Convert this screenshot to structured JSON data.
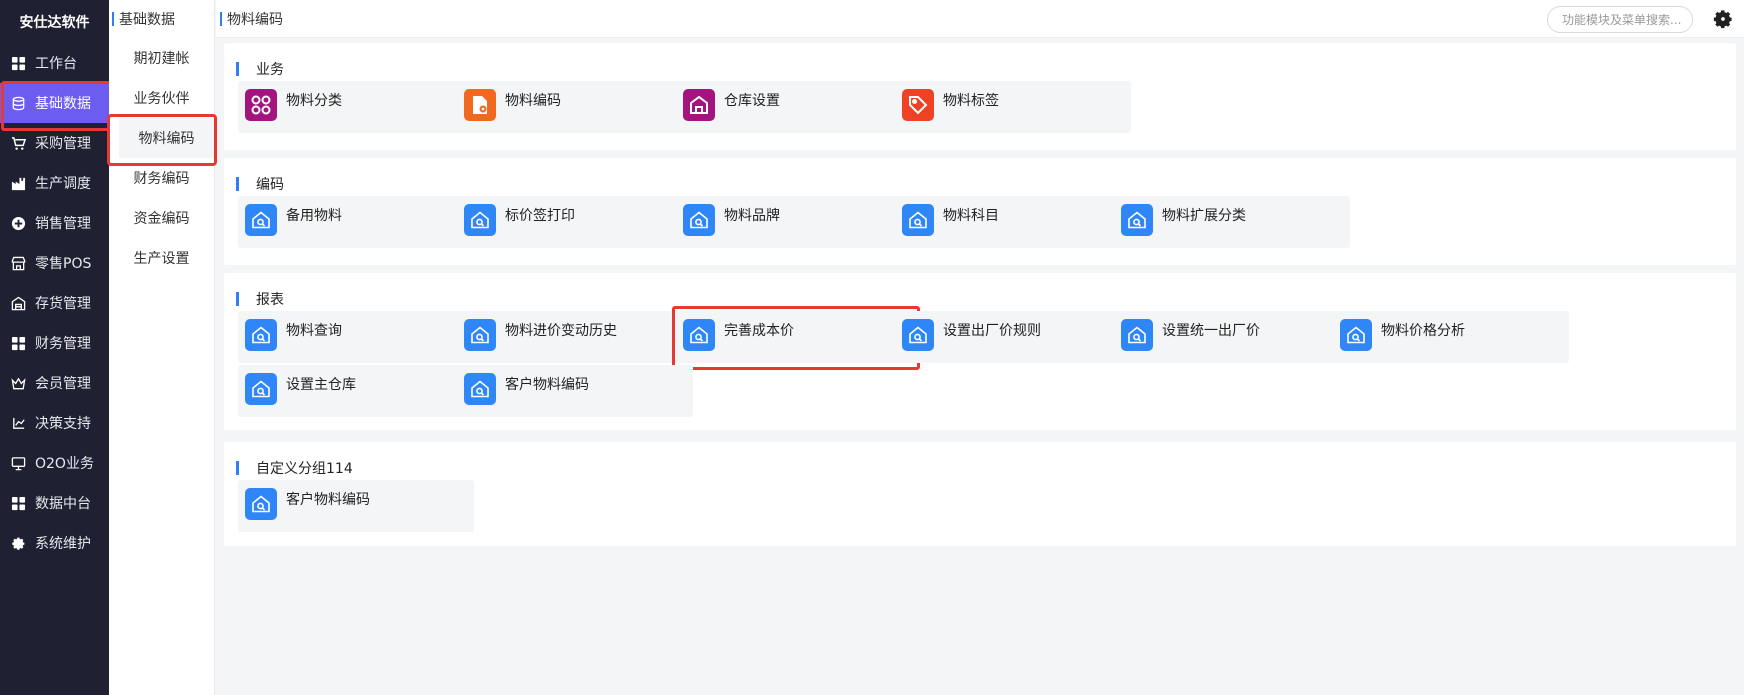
{
  "sidebar": {
    "brand": "安仕达软件",
    "items": [
      {
        "label": "工作台",
        "icon": "grid-icon"
      },
      {
        "label": "基础数据",
        "icon": "database-icon",
        "active": true
      },
      {
        "label": "采购管理",
        "icon": "cart-icon"
      },
      {
        "label": "生产调度",
        "icon": "factory-icon"
      },
      {
        "label": "销售管理",
        "icon": "sales-icon"
      },
      {
        "label": "零售POS",
        "icon": "store-icon"
      },
      {
        "label": "存货管理",
        "icon": "warehouse-icon"
      },
      {
        "label": "财务管理",
        "icon": "grid-icon"
      },
      {
        "label": "会员管理",
        "icon": "crown-icon"
      },
      {
        "label": "决策支持",
        "icon": "decision-icon"
      },
      {
        "label": "O2O业务",
        "icon": "monitor-icon"
      },
      {
        "label": "数据中台",
        "icon": "grid-icon"
      },
      {
        "label": "系统维护",
        "icon": "gear-icon"
      }
    ]
  },
  "submenu": {
    "title": "基础数据",
    "items": [
      {
        "label": "期初建帐"
      },
      {
        "label": "业务伙伴"
      },
      {
        "label": "物料编码",
        "active": true
      },
      {
        "label": "财务编码"
      },
      {
        "label": "资金编码"
      },
      {
        "label": "生产设置"
      }
    ]
  },
  "topbar": {
    "breadcrumb": "物料编码",
    "search_placeholder": "功能模块及菜单搜索..."
  },
  "sections": [
    {
      "title": "业务",
      "tiles": [
        {
          "label": "物料分类",
          "icon": "category-icon",
          "color": "#a3157e"
        },
        {
          "label": "物料编码",
          "icon": "document-gear-icon",
          "color": "#f0691e"
        },
        {
          "label": "仓库设置",
          "icon": "warehouse-icon",
          "color": "#a3157e"
        },
        {
          "label": "物料标签",
          "icon": "tag-icon",
          "color": "#ee4224"
        }
      ]
    },
    {
      "title": "编码",
      "tiles": [
        {
          "label": "备用物料",
          "icon": "home-search-icon",
          "color": "#2f86f6"
        },
        {
          "label": "标价签打印",
          "icon": "home-search-icon",
          "color": "#2f86f6"
        },
        {
          "label": "物料品牌",
          "icon": "home-search-icon",
          "color": "#2f86f6"
        },
        {
          "label": "物料科目",
          "icon": "home-search-icon",
          "color": "#2f86f6"
        },
        {
          "label": "物料扩展分类",
          "icon": "home-search-icon",
          "color": "#2f86f6"
        }
      ]
    },
    {
      "title": "报表",
      "tiles": [
        {
          "label": "物料查询",
          "icon": "home-search-icon",
          "color": "#2f86f6"
        },
        {
          "label": "物料进价变动历史",
          "icon": "home-search-icon",
          "color": "#2f86f6"
        },
        {
          "label": "完善成本价",
          "icon": "home-search-icon",
          "color": "#2f86f6",
          "highlighted": true
        },
        {
          "label": "设置出厂价规则",
          "icon": "home-search-icon",
          "color": "#2f86f6"
        },
        {
          "label": "设置统一出厂价",
          "icon": "home-search-icon",
          "color": "#2f86f6"
        },
        {
          "label": "物料价格分析",
          "icon": "home-search-icon",
          "color": "#2f86f6"
        },
        {
          "label": "设置主仓库",
          "icon": "home-search-icon",
          "color": "#2f86f6"
        },
        {
          "label": "客户物料编码",
          "icon": "home-search-icon",
          "color": "#2f86f6"
        }
      ]
    },
    {
      "title": "自定义分组114",
      "tiles": [
        {
          "label": "客户物料编码",
          "icon": "home-search-icon",
          "color": "#2f86f6"
        }
      ]
    }
  ]
}
